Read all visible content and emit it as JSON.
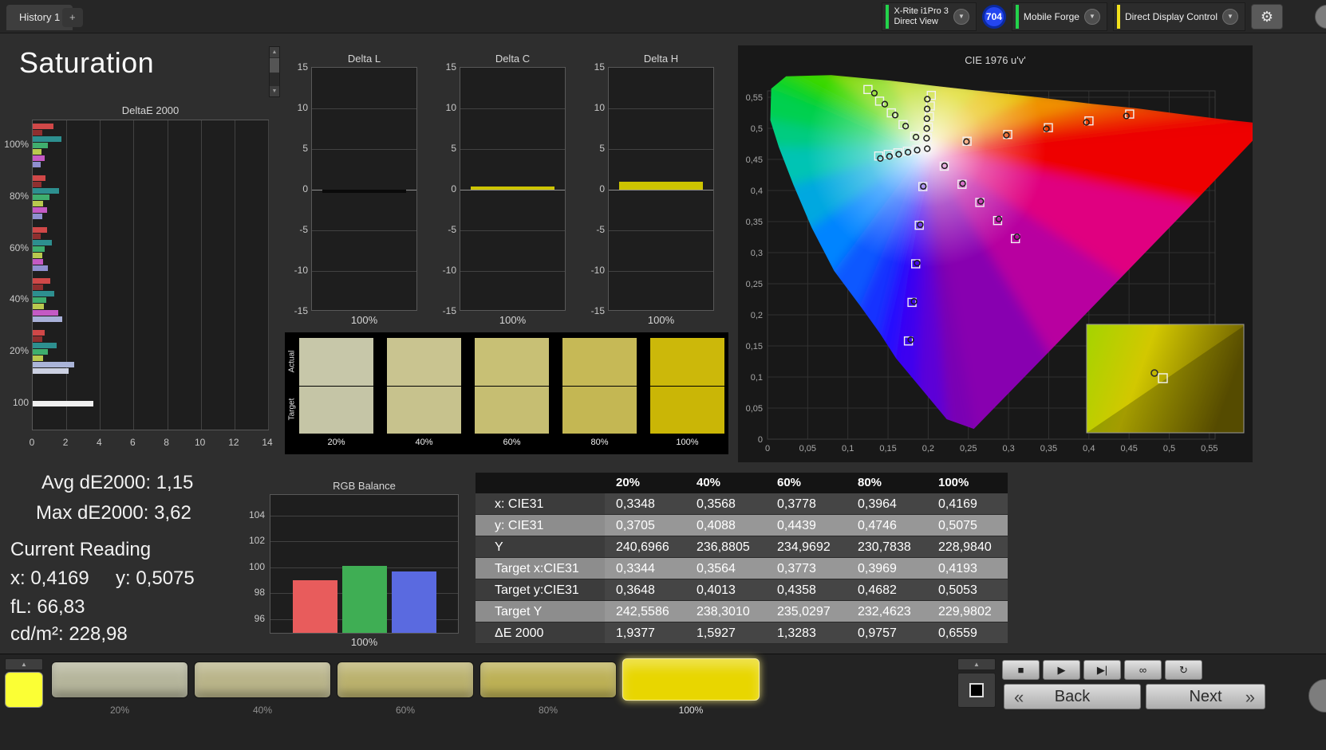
{
  "topbar": {
    "history_tab": "History 1",
    "add_tab": "+",
    "meter": {
      "line1": "X-Rite i1Pro 3",
      "line2": "Direct View",
      "accent": "#23d24b"
    },
    "badge": "704",
    "source": {
      "label": "Mobile Forge",
      "accent": "#23d24b"
    },
    "display": {
      "label": "Direct Display Control",
      "accent": "#f2e11c"
    }
  },
  "page_title": "Saturation",
  "de2000": {
    "title": "DeltaE 2000",
    "x_ticks": [
      0,
      2,
      4,
      6,
      8,
      10,
      12,
      14
    ],
    "x_max": 14,
    "groups": [
      {
        "label": "100%",
        "bars": [
          {
            "v": 1.25,
            "c": "#d04848"
          },
          {
            "v": 0.55,
            "c": "#8f2f2f"
          },
          {
            "v": 1.7,
            "c": "#2d8f8f"
          },
          {
            "v": 0.9,
            "c": "#3fae6e"
          },
          {
            "v": 0.5,
            "c": "#b9c94e"
          },
          {
            "v": 0.7,
            "c": "#c45ac4"
          },
          {
            "v": 0.45,
            "c": "#8f8fd0"
          }
        ]
      },
      {
        "label": "80%",
        "bars": [
          {
            "v": 0.75,
            "c": "#d04848"
          },
          {
            "v": 0.5,
            "c": "#8f2f2f"
          },
          {
            "v": 1.55,
            "c": "#2d8f8f"
          },
          {
            "v": 1.0,
            "c": "#3fae6e"
          },
          {
            "v": 0.6,
            "c": "#b9c94e"
          },
          {
            "v": 0.85,
            "c": "#c45ac4"
          },
          {
            "v": 0.55,
            "c": "#8f8fd0"
          }
        ]
      },
      {
        "label": "60%",
        "bars": [
          {
            "v": 0.85,
            "c": "#d04848"
          },
          {
            "v": 0.45,
            "c": "#8f2f2f"
          },
          {
            "v": 1.15,
            "c": "#2d8f8f"
          },
          {
            "v": 0.7,
            "c": "#3fae6e"
          },
          {
            "v": 0.55,
            "c": "#b9c94e"
          },
          {
            "v": 0.6,
            "c": "#c45ac4"
          },
          {
            "v": 0.9,
            "c": "#8f8fd0"
          }
        ]
      },
      {
        "label": "40%",
        "bars": [
          {
            "v": 1.05,
            "c": "#d04848"
          },
          {
            "v": 0.6,
            "c": "#8f2f2f"
          },
          {
            "v": 1.3,
            "c": "#2d8f8f"
          },
          {
            "v": 0.8,
            "c": "#3fae6e"
          },
          {
            "v": 0.65,
            "c": "#b9c94e"
          },
          {
            "v": 1.5,
            "c": "#c45ac4"
          },
          {
            "v": 1.75,
            "c": "#a8b0d8"
          }
        ]
      },
      {
        "label": "20%",
        "bars": [
          {
            "v": 0.7,
            "c": "#d04848"
          },
          {
            "v": 0.55,
            "c": "#8f2f2f"
          },
          {
            "v": 1.4,
            "c": "#2d8f8f"
          },
          {
            "v": 0.9,
            "c": "#3fae6e"
          },
          {
            "v": 0.6,
            "c": "#b9c94e"
          },
          {
            "v": 2.45,
            "c": "#aab4d8"
          },
          {
            "v": 2.15,
            "c": "#ccd1e2"
          }
        ]
      },
      {
        "label": "100",
        "bars": [
          {
            "v": 3.62,
            "c": "#f0f0f0"
          }
        ]
      }
    ]
  },
  "delta_charts": {
    "y_ticks": [
      15,
      10,
      5,
      0,
      -5,
      -10,
      -15
    ],
    "x_label": "100%",
    "charts": [
      {
        "title": "Delta L",
        "value": -0.3,
        "color": "#0a0a0a"
      },
      {
        "title": "Delta C",
        "value": 0.35,
        "color": "#cdc400"
      },
      {
        "title": "Delta H",
        "value": 0.95,
        "color": "#cdc400"
      }
    ]
  },
  "swatch_panel": {
    "row_labels": [
      "Actual",
      "Target"
    ],
    "items": [
      {
        "label": "20%",
        "actual": "#c7c7a9",
        "target": "#c5c5a6"
      },
      {
        "label": "40%",
        "actual": "#c9c490",
        "target": "#c7c28d"
      },
      {
        "label": "60%",
        "actual": "#c8c075",
        "target": "#c6be72"
      },
      {
        "label": "80%",
        "actual": "#c6b956",
        "target": "#c4b753"
      },
      {
        "label": "100%",
        "actual": "#ccb80a",
        "target": "#cab606"
      }
    ]
  },
  "cie": {
    "title": "CIE 1976 u'v'",
    "axis_ticks": [
      "0",
      "0,05",
      "0,1",
      "0,15",
      "0,2",
      "0,25",
      "0,3",
      "0,35",
      "0,4",
      "0,45",
      "0,5",
      "0,55"
    ],
    "white_point": [
      0.1978,
      0.4683
    ],
    "levels": [
      0.2,
      0.4,
      0.6,
      0.8,
      1.0
    ],
    "sweeps": [
      {
        "name": "red",
        "primary": [
          0.4507,
          0.5229
        ],
        "offset": [
          -0.004,
          -0.003
        ]
      },
      {
        "name": "green",
        "primary": [
          0.125,
          0.5625
        ],
        "offset": [
          0.008,
          -0.006
        ]
      },
      {
        "name": "blue",
        "primary": [
          0.1754,
          0.1579
        ],
        "offset": [
          0.003,
          0.002
        ]
      },
      {
        "name": "cyan",
        "primary": [
          0.1384,
          0.4555
        ],
        "offset": [
          0.002,
          -0.004
        ]
      },
      {
        "name": "magenta",
        "primary": [
          0.3085,
          0.3225
        ],
        "offset": [
          0.002,
          0.003
        ]
      },
      {
        "name": "yellow",
        "primary": [
          0.2039,
          0.5529
        ],
        "offset": [
          -0.005,
          -0.006
        ]
      }
    ]
  },
  "stats": {
    "avg": "Avg dE2000: 1,15",
    "max": "Max dE2000: 3,62",
    "heading": "Current Reading",
    "x": "x: 0,4169",
    "y": "y: 0,5075",
    "fl": "fL: 66,83",
    "cd": "cd/m²: 228,98"
  },
  "rgb_balance": {
    "title": "RGB Balance",
    "y_ticks": [
      104,
      102,
      100,
      98,
      96
    ],
    "x_label": "100%",
    "bars": [
      {
        "name": "red",
        "value": 99.0,
        "color": "#e85c5c"
      },
      {
        "name": "green",
        "value": 100.1,
        "color": "#3fae54"
      },
      {
        "name": "blue",
        "value": 99.7,
        "color": "#5a6ae0"
      }
    ]
  },
  "table": {
    "columns": [
      "20%",
      "40%",
      "60%",
      "80%",
      "100%"
    ],
    "rows": [
      {
        "label": "x: CIE31",
        "values": [
          "0,3348",
          "0,3568",
          "0,3778",
          "0,3964",
          "0,4169"
        ]
      },
      {
        "label": "y: CIE31",
        "values": [
          "0,3705",
          "0,4088",
          "0,4439",
          "0,4746",
          "0,5075"
        ]
      },
      {
        "label": "Y",
        "values": [
          "240,6966",
          "236,8805",
          "234,9692",
          "230,7838",
          "228,9840"
        ]
      },
      {
        "label": "Target x:CIE31",
        "values": [
          "0,3344",
          "0,3564",
          "0,3773",
          "0,3969",
          "0,4193"
        ]
      },
      {
        "label": "Target y:CIE31",
        "values": [
          "0,3648",
          "0,4013",
          "0,4358",
          "0,4682",
          "0,5053"
        ]
      },
      {
        "label": "Target Y",
        "values": [
          "242,5586",
          "238,3010",
          "235,0297",
          "232,4623",
          "229,9802"
        ]
      },
      {
        "label": "ΔE 2000",
        "values": [
          "1,9377",
          "1,5927",
          "1,3283",
          "0,9757",
          "0,6559"
        ]
      }
    ]
  },
  "bottom": {
    "current_patch_color": "#fbff35",
    "patches": [
      {
        "label": "20%",
        "color": "#b5b59b",
        "selected": false
      },
      {
        "label": "40%",
        "color": "#b9b489",
        "selected": false
      },
      {
        "label": "60%",
        "color": "#bab16d",
        "selected": false
      },
      {
        "label": "80%",
        "color": "#bcb055",
        "selected": false
      },
      {
        "label": "100%",
        "color": "#e8d600",
        "selected": true
      }
    ],
    "transport": [
      {
        "name": "stop",
        "glyph": "■"
      },
      {
        "name": "play",
        "glyph": "▶"
      },
      {
        "name": "step",
        "glyph": "▶|"
      },
      {
        "name": "continuous",
        "glyph": "∞"
      },
      {
        "name": "loop",
        "glyph": "↻"
      }
    ],
    "back": "Back",
    "next": "Next",
    "back_chevron": "«",
    "next_chevron": "»"
  },
  "icons": {
    "dropdown": "▼",
    "up_arrow": "▲",
    "down_arrow": "▼",
    "gear": "⚙"
  }
}
